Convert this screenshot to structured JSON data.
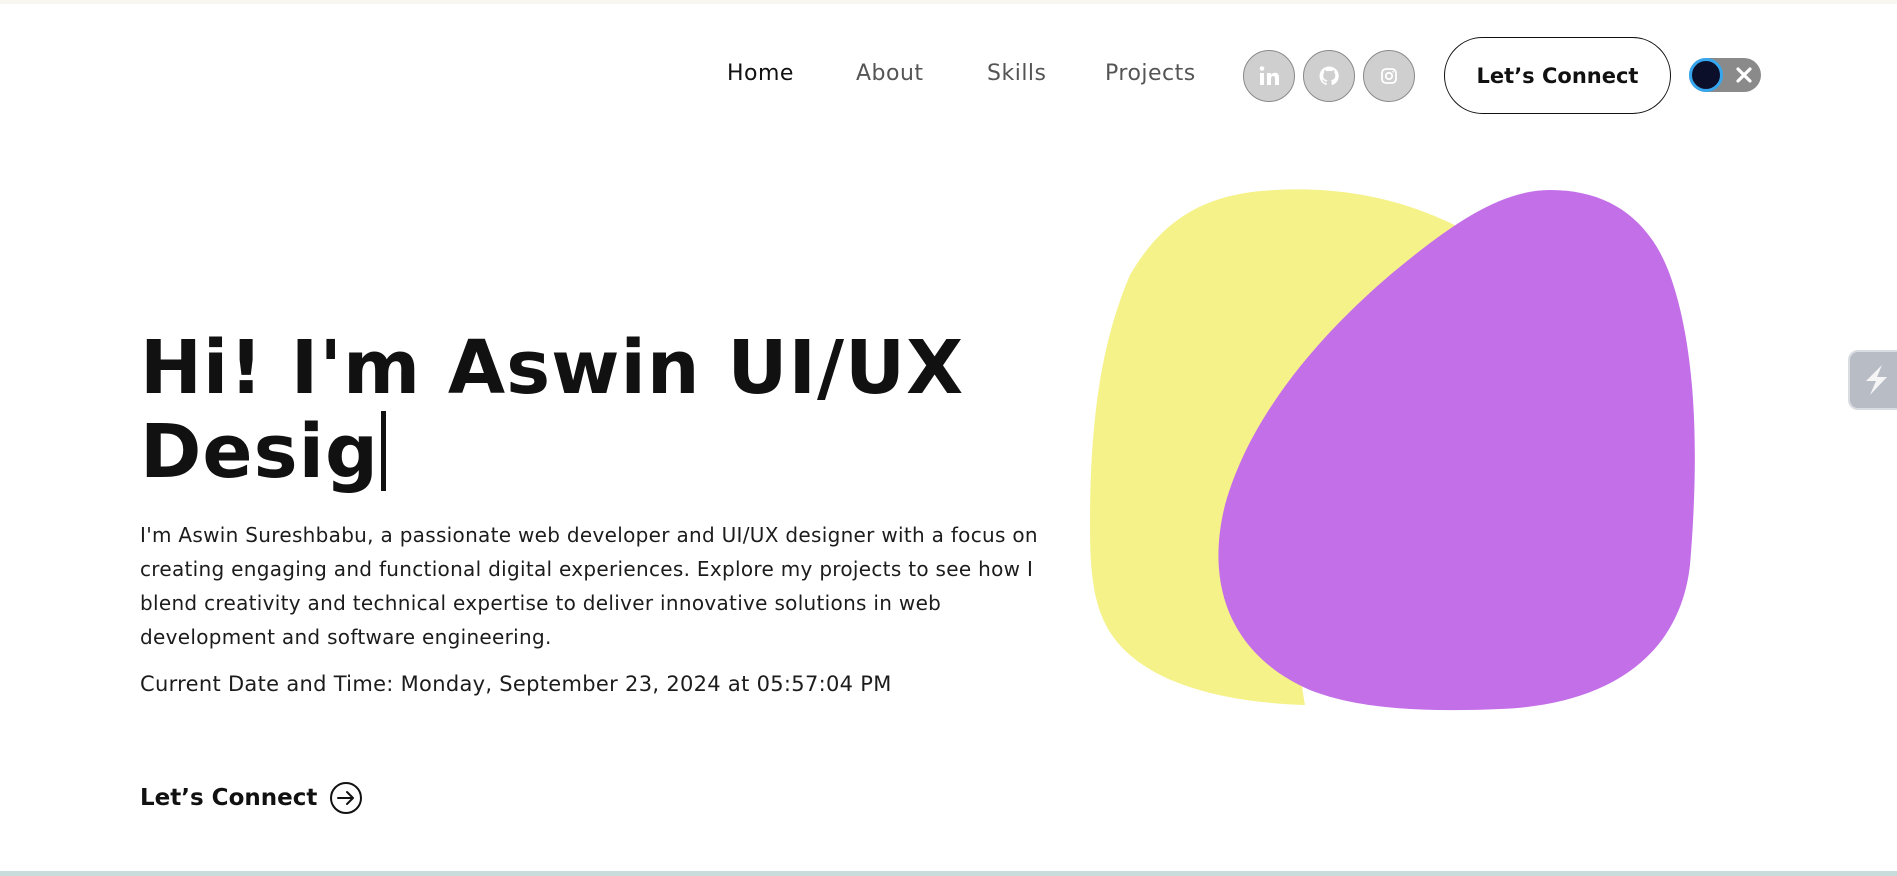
{
  "nav": {
    "links": [
      "Home",
      "About",
      "Skills",
      "Projects"
    ],
    "active": "Home",
    "social": [
      "linkedin-icon",
      "github-icon",
      "instagram-icon"
    ],
    "connect_label": "Let’s Connect"
  },
  "hero": {
    "title_line1": "Hi! I'm Aswin UI/UX",
    "title_line2": "Desig",
    "intro": "I'm Aswin Sureshbabu, a passionate web developer and UI/UX designer with a focus on creating engaging and functional digital experiences. Explore my projects to see how I blend creativity and technical expertise to deliver innovative solutions in web development and software engineering.",
    "datetime": "Current Date and Time: Monday, September 23, 2024 at 05:57:04 PM",
    "cta_label": "Let’s Connect"
  },
  "icons": {
    "cta": "arrow-right-circle-icon",
    "theme_toggle": "dark-mode-toggle",
    "side_tab": "extension-icon"
  },
  "colors": {
    "blob_yellow": "#F5F28A",
    "blob_purple": "#C36FE8",
    "toggle_bg": "#8A8A8A",
    "toggle_knob": "#0C0F2A",
    "toggle_ring": "#36A7EE"
  }
}
